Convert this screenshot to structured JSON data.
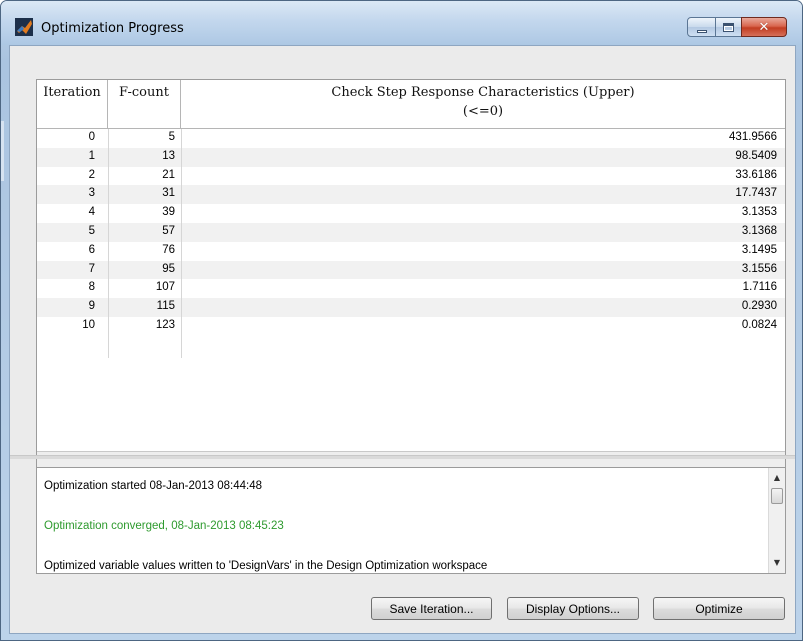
{
  "window": {
    "title": "Optimization Progress",
    "icon": "matlab-icon",
    "controls": [
      "minimize-icon",
      "maximize-icon",
      "close-icon"
    ],
    "colors": {
      "accent_close": "#c23d22",
      "converged_text": "#2e9a2e"
    }
  },
  "table": {
    "headers": {
      "iteration": "Iteration",
      "fcount": "F-count",
      "check": "Check Step Response  Characteristics (Upper)",
      "check_sub": "(<=0)"
    },
    "rows": [
      {
        "iteration": "0",
        "fcount": "5",
        "value": "431.9566"
      },
      {
        "iteration": "1",
        "fcount": "13",
        "value": "98.5409"
      },
      {
        "iteration": "2",
        "fcount": "21",
        "value": "33.6186"
      },
      {
        "iteration": "3",
        "fcount": "31",
        "value": "17.7437"
      },
      {
        "iteration": "4",
        "fcount": "39",
        "value": "3.1353"
      },
      {
        "iteration": "5",
        "fcount": "57",
        "value": "3.1368"
      },
      {
        "iteration": "6",
        "fcount": "76",
        "value": "3.1495"
      },
      {
        "iteration": "7",
        "fcount": "95",
        "value": "3.1556"
      },
      {
        "iteration": "8",
        "fcount": "107",
        "value": "1.7116"
      },
      {
        "iteration": "9",
        "fcount": "115",
        "value": "0.2930"
      },
      {
        "iteration": "10",
        "fcount": "123",
        "value": "0.0824"
      }
    ]
  },
  "log": {
    "lines": [
      "Optimization started 08-Jan-2013 08:44:48",
      "Optimization converged, 08-Jan-2013 08:45:23",
      "Optimized variable values written to 'DesignVars' in the Design Optimization workspace"
    ]
  },
  "buttons": {
    "save": "Save Iteration...",
    "display": "Display Options...",
    "optimize": "Optimize"
  }
}
